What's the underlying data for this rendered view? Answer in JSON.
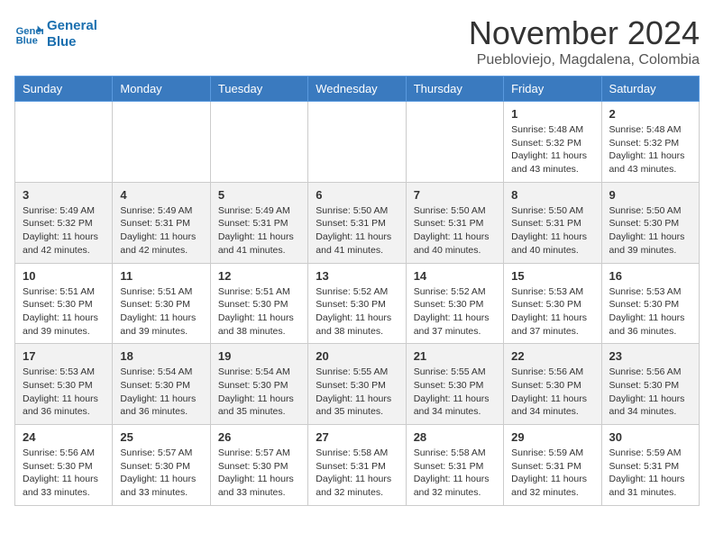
{
  "header": {
    "logo_line1": "General",
    "logo_line2": "Blue",
    "month": "November 2024",
    "location": "Puebloviejo, Magdalena, Colombia"
  },
  "weekdays": [
    "Sunday",
    "Monday",
    "Tuesday",
    "Wednesday",
    "Thursday",
    "Friday",
    "Saturday"
  ],
  "weeks": [
    [
      {
        "day": "",
        "info": ""
      },
      {
        "day": "",
        "info": ""
      },
      {
        "day": "",
        "info": ""
      },
      {
        "day": "",
        "info": ""
      },
      {
        "day": "",
        "info": ""
      },
      {
        "day": "1",
        "info": "Sunrise: 5:48 AM\nSunset: 5:32 PM\nDaylight: 11 hours and 43 minutes."
      },
      {
        "day": "2",
        "info": "Sunrise: 5:48 AM\nSunset: 5:32 PM\nDaylight: 11 hours and 43 minutes."
      }
    ],
    [
      {
        "day": "3",
        "info": "Sunrise: 5:49 AM\nSunset: 5:32 PM\nDaylight: 11 hours and 42 minutes."
      },
      {
        "day": "4",
        "info": "Sunrise: 5:49 AM\nSunset: 5:31 PM\nDaylight: 11 hours and 42 minutes."
      },
      {
        "day": "5",
        "info": "Sunrise: 5:49 AM\nSunset: 5:31 PM\nDaylight: 11 hours and 41 minutes."
      },
      {
        "day": "6",
        "info": "Sunrise: 5:50 AM\nSunset: 5:31 PM\nDaylight: 11 hours and 41 minutes."
      },
      {
        "day": "7",
        "info": "Sunrise: 5:50 AM\nSunset: 5:31 PM\nDaylight: 11 hours and 40 minutes."
      },
      {
        "day": "8",
        "info": "Sunrise: 5:50 AM\nSunset: 5:31 PM\nDaylight: 11 hours and 40 minutes."
      },
      {
        "day": "9",
        "info": "Sunrise: 5:50 AM\nSunset: 5:30 PM\nDaylight: 11 hours and 39 minutes."
      }
    ],
    [
      {
        "day": "10",
        "info": "Sunrise: 5:51 AM\nSunset: 5:30 PM\nDaylight: 11 hours and 39 minutes."
      },
      {
        "day": "11",
        "info": "Sunrise: 5:51 AM\nSunset: 5:30 PM\nDaylight: 11 hours and 39 minutes."
      },
      {
        "day": "12",
        "info": "Sunrise: 5:51 AM\nSunset: 5:30 PM\nDaylight: 11 hours and 38 minutes."
      },
      {
        "day": "13",
        "info": "Sunrise: 5:52 AM\nSunset: 5:30 PM\nDaylight: 11 hours and 38 minutes."
      },
      {
        "day": "14",
        "info": "Sunrise: 5:52 AM\nSunset: 5:30 PM\nDaylight: 11 hours and 37 minutes."
      },
      {
        "day": "15",
        "info": "Sunrise: 5:53 AM\nSunset: 5:30 PM\nDaylight: 11 hours and 37 minutes."
      },
      {
        "day": "16",
        "info": "Sunrise: 5:53 AM\nSunset: 5:30 PM\nDaylight: 11 hours and 36 minutes."
      }
    ],
    [
      {
        "day": "17",
        "info": "Sunrise: 5:53 AM\nSunset: 5:30 PM\nDaylight: 11 hours and 36 minutes."
      },
      {
        "day": "18",
        "info": "Sunrise: 5:54 AM\nSunset: 5:30 PM\nDaylight: 11 hours and 36 minutes."
      },
      {
        "day": "19",
        "info": "Sunrise: 5:54 AM\nSunset: 5:30 PM\nDaylight: 11 hours and 35 minutes."
      },
      {
        "day": "20",
        "info": "Sunrise: 5:55 AM\nSunset: 5:30 PM\nDaylight: 11 hours and 35 minutes."
      },
      {
        "day": "21",
        "info": "Sunrise: 5:55 AM\nSunset: 5:30 PM\nDaylight: 11 hours and 34 minutes."
      },
      {
        "day": "22",
        "info": "Sunrise: 5:56 AM\nSunset: 5:30 PM\nDaylight: 11 hours and 34 minutes."
      },
      {
        "day": "23",
        "info": "Sunrise: 5:56 AM\nSunset: 5:30 PM\nDaylight: 11 hours and 34 minutes."
      }
    ],
    [
      {
        "day": "24",
        "info": "Sunrise: 5:56 AM\nSunset: 5:30 PM\nDaylight: 11 hours and 33 minutes."
      },
      {
        "day": "25",
        "info": "Sunrise: 5:57 AM\nSunset: 5:30 PM\nDaylight: 11 hours and 33 minutes."
      },
      {
        "day": "26",
        "info": "Sunrise: 5:57 AM\nSunset: 5:30 PM\nDaylight: 11 hours and 33 minutes."
      },
      {
        "day": "27",
        "info": "Sunrise: 5:58 AM\nSunset: 5:31 PM\nDaylight: 11 hours and 32 minutes."
      },
      {
        "day": "28",
        "info": "Sunrise: 5:58 AM\nSunset: 5:31 PM\nDaylight: 11 hours and 32 minutes."
      },
      {
        "day": "29",
        "info": "Sunrise: 5:59 AM\nSunset: 5:31 PM\nDaylight: 11 hours and 32 minutes."
      },
      {
        "day": "30",
        "info": "Sunrise: 5:59 AM\nSunset: 5:31 PM\nDaylight: 11 hours and 31 minutes."
      }
    ]
  ]
}
